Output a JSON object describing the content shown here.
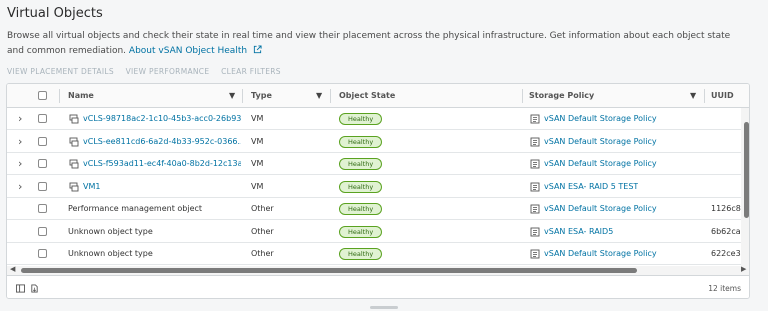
{
  "page": {
    "title": "Virtual Objects",
    "description": "Browse all virtual objects and check their state in real time and view their placement across the physical infrastructure. Get information about each object state and common remediation.",
    "help_link": "About vSAN Object Health"
  },
  "actions": {
    "view_placement": "VIEW PLACEMENT DETAILS",
    "view_performance": "VIEW PERFORMANCE",
    "clear_filters": "CLEAR FILTERS"
  },
  "table": {
    "headers": {
      "name": "Name",
      "type": "Type",
      "state": "Object State",
      "policy": "Storage Policy",
      "uuid": "UUID"
    },
    "rows": [
      {
        "name": "vCLS-98718ac2-1c10-45b3-acc0-26b93...",
        "type": "VM",
        "state": "Healthy",
        "policy": "vSAN Default Storage Policy",
        "uuid": ""
      },
      {
        "name": "vCLS-ee811cd6-6a2d-4b33-952c-0366...",
        "type": "VM",
        "state": "Healthy",
        "policy": "vSAN Default Storage Policy",
        "uuid": ""
      },
      {
        "name": "vCLS-f593ad11-ec4f-40a0-8b2d-12c13a...",
        "type": "VM",
        "state": "Healthy",
        "policy": "vSAN Default Storage Policy",
        "uuid": ""
      },
      {
        "name": "VM1",
        "type": "VM",
        "state": "Healthy",
        "policy": "vSAN ESA- RAID 5 TEST",
        "uuid": ""
      },
      {
        "name": "Performance management object",
        "type": "Other",
        "state": "Healthy",
        "policy": "vSAN Default Storage Policy",
        "uuid": "1126c86"
      },
      {
        "name": "Unknown object type",
        "type": "Other",
        "state": "Healthy",
        "policy": "vSAN ESA- RAID5",
        "uuid": "6b62ca"
      },
      {
        "name": "Unknown object type",
        "type": "Other",
        "state": "Healthy",
        "policy": "vSAN Default Storage Policy",
        "uuid": "622ce3"
      }
    ]
  },
  "footer": {
    "count": "12 items"
  },
  "colors": {
    "link": "#0072a3",
    "healthy_bg": "#e0f2d2",
    "healthy_border": "#5aa220"
  },
  "icons": [
    "external-link-icon",
    "vm-icon",
    "storage-policy-icon",
    "filter-icon",
    "chevron-right-icon",
    "column-toggle-icon",
    "export-icon"
  ]
}
